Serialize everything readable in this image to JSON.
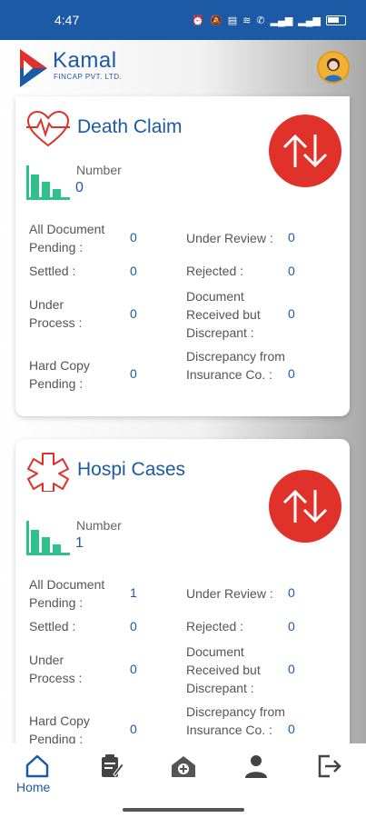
{
  "status_bar": {
    "time": "4:47",
    "battery": "39"
  },
  "brand": {
    "name": "Kamal",
    "tagline": "FINCAP PVT. LTD."
  },
  "colors": {
    "primary": "#1c5aa6",
    "accent_red": "#e0312b",
    "chart_green": "#2ec28a"
  },
  "cards": [
    {
      "title": "Death Claim",
      "icon": "heartbeat-icon",
      "number_label": "Number",
      "number_value": "0",
      "rows": [
        {
          "label": "All Document Pending :",
          "value": "0"
        },
        {
          "label": "Under Review :",
          "value": "0"
        },
        {
          "label": "Settled :",
          "value": "0"
        },
        {
          "label": "Rejected :",
          "value": "0"
        },
        {
          "label": "Under Process :",
          "value": "0"
        },
        {
          "label": "Document Received but Discrepant :",
          "value": "0"
        },
        {
          "label": "Hard Copy Pending :",
          "value": "0"
        },
        {
          "label": "Discrepancy from Insurance Co. :",
          "value": "0"
        }
      ]
    },
    {
      "title": "Hospi Cases",
      "icon": "medical-star-icon",
      "number_label": "Number",
      "number_value": "1",
      "rows": [
        {
          "label": "All Document Pending :",
          "value": "1"
        },
        {
          "label": "Under Review :",
          "value": "0"
        },
        {
          "label": "Settled :",
          "value": "0"
        },
        {
          "label": "Rejected :",
          "value": "0"
        },
        {
          "label": "Under Process :",
          "value": "0"
        },
        {
          "label": "Document Received but Discrepant :",
          "value": "0"
        },
        {
          "label": "Hard Copy Pending :",
          "value": "0"
        },
        {
          "label": "Discrepancy from Insurance Co. :",
          "value": "0"
        }
      ]
    }
  ],
  "nav": {
    "home_label": "Home",
    "items": [
      "home-icon",
      "claim-form-icon",
      "hospital-icon",
      "profile-icon",
      "logout-icon"
    ]
  }
}
